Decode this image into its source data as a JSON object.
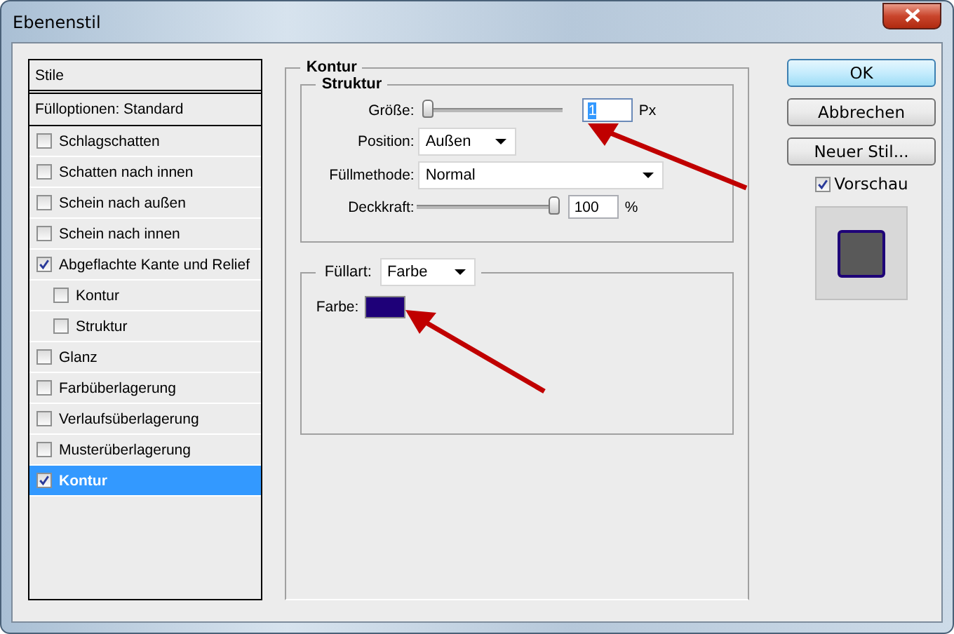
{
  "window": {
    "title": "Ebenenstil"
  },
  "styles": {
    "header": "Stile",
    "blending": "Fülloptionen: Standard",
    "items": [
      {
        "label": "Schlagschatten",
        "checked": false,
        "selected": false
      },
      {
        "label": "Schatten nach innen",
        "checked": false,
        "selected": false
      },
      {
        "label": "Schein nach außen",
        "checked": false,
        "selected": false
      },
      {
        "label": "Schein nach innen",
        "checked": false,
        "selected": false
      },
      {
        "label": "Abgeflachte Kante und Relief",
        "checked": true,
        "selected": false,
        "children": [
          {
            "label": "Kontur",
            "checked": false,
            "selected": false
          },
          {
            "label": "Struktur",
            "checked": false,
            "selected": false
          }
        ]
      },
      {
        "label": "Glanz",
        "checked": false,
        "selected": false
      },
      {
        "label": "Farbüberlagerung",
        "checked": false,
        "selected": false
      },
      {
        "label": "Verlaufsüberlagerung",
        "checked": false,
        "selected": false
      },
      {
        "label": "Musterüberlagerung",
        "checked": false,
        "selected": false
      },
      {
        "label": "Kontur",
        "checked": true,
        "selected": true
      }
    ]
  },
  "kontur": {
    "title": "Kontur",
    "struktur": {
      "title": "Struktur",
      "size": {
        "label": "Größe:",
        "level": 0.02,
        "value": "1",
        "highlighted": true,
        "unit": "Px"
      },
      "position": {
        "label": "Position:",
        "value": "Außen"
      },
      "blend_mode": {
        "label": "Füllmethode:",
        "value": "Normal"
      },
      "opacity": {
        "label": "Deckkraft:",
        "level": 1,
        "value": "100",
        "unit": "%"
      }
    },
    "fill": {
      "label": "Füllart:",
      "value": "Farbe",
      "color_label": "Farbe:",
      "color": "#1e0078"
    }
  },
  "buttons": [
    {
      "label": "OK",
      "default": true
    },
    {
      "label": "Abbrechen",
      "default": false
    },
    {
      "label": "Neuer Stil...",
      "default": false
    }
  ],
  "preview": {
    "label": "Vorschau",
    "checked": true
  }
}
